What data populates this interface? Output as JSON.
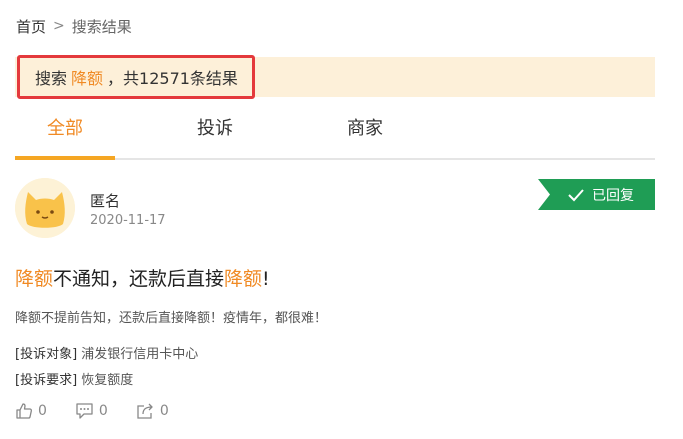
{
  "breadcrumb": {
    "home": "首页",
    "separator": ">",
    "current": "搜索结果"
  },
  "search_summary": {
    "prefix": "搜索",
    "keyword": "降额",
    "result_text": "，共12571条结果"
  },
  "tabs": [
    {
      "label": "全部",
      "active": true
    },
    {
      "label": "投诉",
      "active": false
    },
    {
      "label": "商家",
      "active": false
    }
  ],
  "complaint": {
    "author": "匿名",
    "date": "2020-11-17",
    "status": "已回复",
    "title_parts": [
      {
        "text": "降额",
        "highlight": true
      },
      {
        "text": "不通知，还款后直接",
        "highlight": false
      },
      {
        "text": "降额",
        "highlight": true
      },
      {
        "text": "!",
        "highlight": false
      }
    ],
    "summary": "降额不提前告知，还款后直接降额！疫情年，都很难！",
    "target_label": "[投诉对象]",
    "target_value": "浦发银行信用卡中心",
    "request_label": "[投诉要求]",
    "request_value": "恢复额度",
    "likes": "0",
    "comments": "0",
    "shares": "0"
  },
  "colors": {
    "accent": "#f08a24",
    "tab_underline": "#f5a623",
    "banner_bg": "#fdf0d9",
    "highlight_border": "#e4393c",
    "status_green": "#1f9d55"
  },
  "icons": {
    "status": "check-icon",
    "like": "thumbs-up-icon",
    "comment": "comment-icon",
    "share": "share-icon",
    "avatar": "cat-avatar-icon"
  }
}
